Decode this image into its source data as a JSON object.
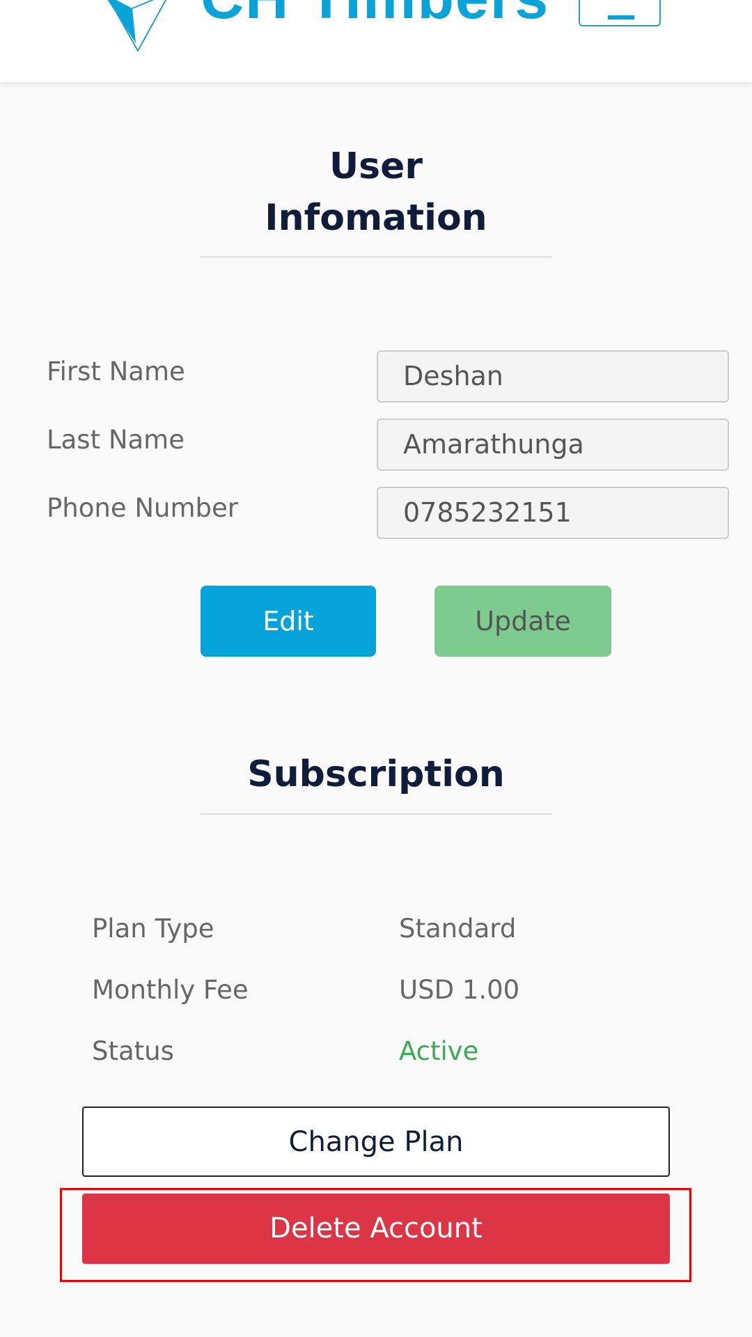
{
  "header": {
    "logo_text": "CH Timbers",
    "menu_icon": "hamburger-icon",
    "brand_color": "#0aa3d8"
  },
  "user_info": {
    "title_line1": "User",
    "title_line2": "Infomation",
    "fields": [
      {
        "label": "First Name",
        "value": "Deshan"
      },
      {
        "label": "Last Name",
        "value": "Amarathunga"
      },
      {
        "label": "Phone Number",
        "value": "0785232151"
      }
    ],
    "edit_label": "Edit",
    "update_label": "Update"
  },
  "subscription": {
    "title": "Subscription",
    "rows": [
      {
        "label": "Plan Type",
        "value": "Standard"
      },
      {
        "label": "Monthly Fee",
        "value": "USD 1.00"
      },
      {
        "label": "Status",
        "value": "Active"
      }
    ],
    "change_plan_label": "Change Plan",
    "delete_account_label": "Delete Account"
  },
  "colors": {
    "edit": "#06a3da",
    "update": "#7dcb8e",
    "delete": "#dc3545",
    "active": "#3aaa55"
  }
}
